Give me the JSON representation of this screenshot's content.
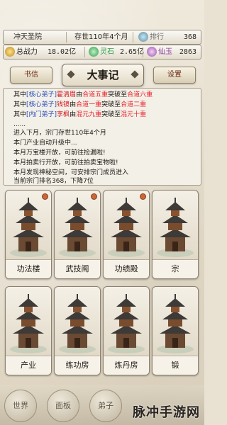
{
  "header": {
    "sect_name": "冲天圣院",
    "age": "存世110年4个月",
    "rank_label": "排行",
    "rank_value": "368",
    "power_label": "总战力",
    "power_value": "18.02亿",
    "stone_label": "灵石",
    "stone_value": "2.65亿",
    "dan_label": "仙玉",
    "dan_value": "2863"
  },
  "toolbar": {
    "letter_label": "书信",
    "title": "大事记",
    "settings_label": "设置"
  },
  "log": {
    "lines": [
      {
        "prefix": "其中",
        "tag": "[核心弟子]",
        "name": "霍清眉",
        "mid": "由",
        "from": "合道五重",
        "mid2": "突破至",
        "to": "合道六重"
      },
      {
        "prefix": "其中",
        "tag": "[核心弟子]",
        "name": "钱镜",
        "mid": "由",
        "from": "合道一重",
        "mid2": "突破至",
        "to": "合道二重"
      },
      {
        "prefix": "其中",
        "tag": "[内门弟子]",
        "name": "李枫",
        "mid": "由",
        "from": "混元九重",
        "mid2": "突破至",
        "to": "混元十重"
      }
    ],
    "ellipsis": "......",
    "advance": "进入下月，宗门存世110年4个月",
    "auto_upgrade": "本门产业自动升级中...",
    "treasure": "本月万宝楼开放，可前往捡漏啦!",
    "auction": "本月拍卖行开放，可前往拍卖宝物啦!",
    "mystery": "本月发现神秘空间，可安排宗门成员进入",
    "ranking": "当前宗门排名368，下降7位"
  },
  "buildings": [
    {
      "label": "功法楼",
      "dot": true
    },
    {
      "label": "武技阁",
      "dot": true
    },
    {
      "label": "功绩殿",
      "dot": true
    },
    {
      "label": "宗",
      "dot": false
    },
    {
      "label": "产业",
      "dot": false
    },
    {
      "label": "练功房",
      "dot": false
    },
    {
      "label": "炼丹房",
      "dot": false
    },
    {
      "label": "锻",
      "dot": false
    }
  ],
  "nav": {
    "world": "世界",
    "item2": "面板",
    "item3": "弟子"
  },
  "watermark": "脉冲手游网",
  "colors": {
    "tag_blue": "#2a4fbf",
    "name_red": "#d6121d",
    "pink": "#e63ea8",
    "green": "#1fa32d"
  }
}
